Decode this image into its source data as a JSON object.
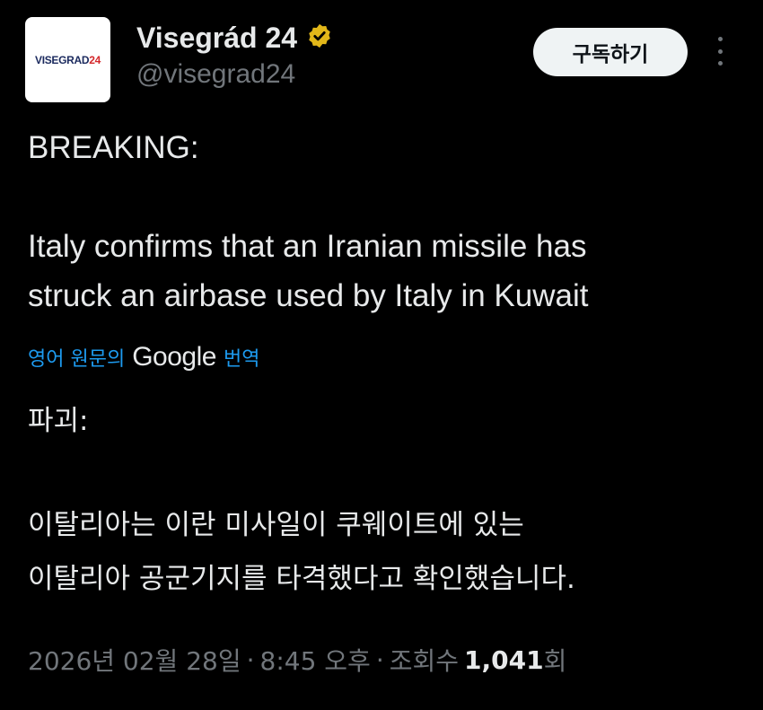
{
  "author": {
    "avatar_text": "VISEGRAD",
    "avatar_num": "24",
    "display_name": "Visegrád 24",
    "handle": "@visegrad24",
    "verified_color": "#e2b719"
  },
  "actions": {
    "subscribe_label": "구독하기"
  },
  "tweet": {
    "line1": "BREAKING:",
    "line2": "Italy confirms that an Iranian missile has",
    "line3": "struck an airbase used by Italy in Kuwait"
  },
  "translation": {
    "prefix": "영어 원문의",
    "provider": "Google",
    "suffix": "번역",
    "line1": "파괴:",
    "line2": "이탈리아는 이란 미사일이 쿠웨이트에 있는",
    "line3": "이탈리아 공군기지를 타격했다고 확인했습니다."
  },
  "meta": {
    "date": "2026년 02월 28일",
    "sep1": "·",
    "time": "8:45 오후",
    "sep2": "·",
    "views_label": "조회수",
    "views_count": "1,041",
    "views_suffix": "회"
  }
}
